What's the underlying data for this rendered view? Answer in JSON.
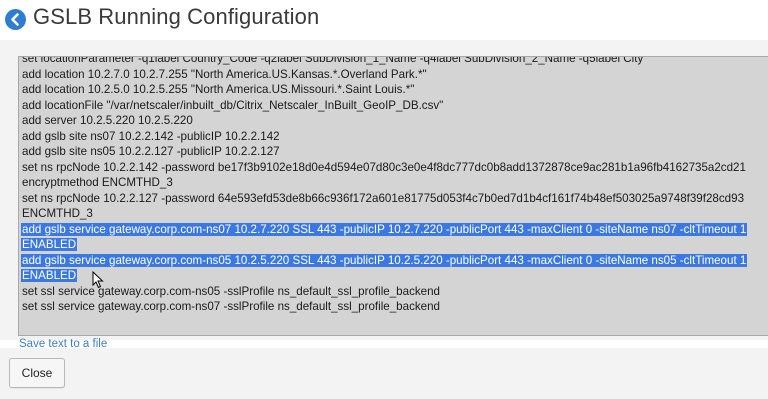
{
  "header": {
    "title": "GSLB Running Configuration",
    "back_icon": "arrow-left-circle-icon",
    "accent_color": "#2e7dd1"
  },
  "config": {
    "lines": [
      {
        "text": "set locationParameter -q1label Country_Code -q2label SubDivision_1_Name -q4label SubDivision_2_Name -q5label City",
        "selected": false
      },
      {
        "text": "add location 10.2.7.0 10.2.7.255 \"North America.US.Kansas.*.Overland Park.*\"",
        "selected": false
      },
      {
        "text": "add location 10.2.5.0 10.2.5.255 \"North America.US.Missouri.*.Saint Louis.*\"",
        "selected": false
      },
      {
        "text": "add locationFile \"/var/netscaler/inbuilt_db/Citrix_Netscaler_InBuilt_GeoIP_DB.csv\"",
        "selected": false
      },
      {
        "text": "add server 10.2.5.220 10.2.5.220",
        "selected": false
      },
      {
        "text": "add gslb site ns07 10.2.2.142 -publicIP 10.2.2.142",
        "selected": false
      },
      {
        "text": "add gslb site ns05 10.2.2.127 -publicIP 10.2.2.127",
        "selected": false
      },
      {
        "text": "set ns rpcNode 10.2.2.142 -password be17f3b9102e18d0e4d594e07d80c3e0e4f8dc777dc0b8add1372878ce9ac281b1a96fb4162735a2cd21",
        "selected": false
      },
      {
        "text": "encryptmethod ENCMTHD_3",
        "selected": false
      },
      {
        "text": "set ns rpcNode 10.2.2.127 -password 64e593efd53de8b66c936f172a601e81775d053f4c7b0ed7d1b4cf161f74b48ef503025a9748f39f28cd93",
        "selected": false
      },
      {
        "text": "ENCMTHD_3",
        "selected": false
      },
      {
        "text": "add gslb service gateway.corp.com-ns07 10.2.7.220 SSL 443 -publicIP 10.2.7.220 -publicPort 443 -maxClient 0 -siteName ns07 -cltTimeout 1",
        "selected": true
      },
      {
        "text": "ENABLED",
        "selected": true
      },
      {
        "text": "add gslb service gateway.corp.com-ns05 10.2.5.220 SSL 443 -publicIP 10.2.5.220 -publicPort 443 -maxClient 0 -siteName ns05 -cltTimeout 1",
        "selected": true
      },
      {
        "text": "ENABLED",
        "selected": true
      },
      {
        "text": "set ssl service gateway.corp.com-ns05 -sslProfile ns_default_ssl_profile_backend",
        "selected": false
      },
      {
        "text": "set ssl service gateway.corp.com-ns07 -sslProfile ns_default_ssl_profile_backend",
        "selected": false
      }
    ],
    "selection_color": "#3b79e0"
  },
  "save_link": "Save text to a file",
  "footer": {
    "close_label": "Close"
  }
}
